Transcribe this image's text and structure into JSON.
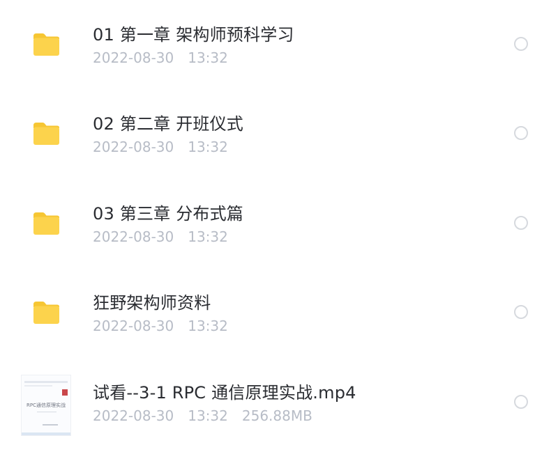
{
  "colors": {
    "folder": "#fcd34c",
    "folder_tab": "#f6c633",
    "name_text": "#2a2c31",
    "meta_text": "#b7bcc6",
    "radio_border": "#d6d9de"
  },
  "files": [
    {
      "icon": "folder-icon",
      "name": "01  第一章  架构师预科学习",
      "date": "2022-08-30",
      "time": "13:32",
      "selected": false
    },
    {
      "icon": "folder-icon",
      "name": "02  第二章  开班仪式",
      "date": "2022-08-30",
      "time": "13:32",
      "selected": false
    },
    {
      "icon": "folder-icon",
      "name": "03  第三章  分布式篇",
      "date": "2022-08-30",
      "time": "13:32",
      "selected": false
    },
    {
      "icon": "folder-icon",
      "name": "狂野架构师资料",
      "date": "2022-08-30",
      "time": "13:32",
      "selected": false
    },
    {
      "icon": "video-thumbnail",
      "thumbnail_title": "RPC通信原理实战",
      "name": "试看--3-1  RPC  通信原理实战.mp4",
      "date": "2022-08-30",
      "time": "13:32",
      "size": "256.88MB",
      "selected": false
    }
  ]
}
